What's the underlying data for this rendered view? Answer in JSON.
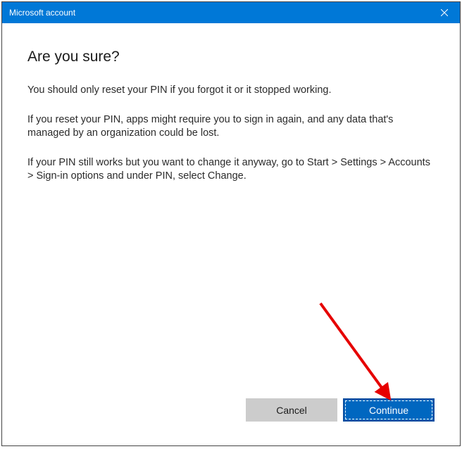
{
  "titlebar": {
    "title": "Microsoft account"
  },
  "dialog": {
    "heading": "Are you sure?",
    "p1": "You should only reset your PIN if you forgot it or it stopped working.",
    "p2": "If you reset your PIN, apps might require you to sign in again, and any data that's managed by an organization could be lost.",
    "p3": "If your PIN still works but you want to change it anyway, go to Start > Settings > Accounts > Sign-in options and under PIN, select Change."
  },
  "buttons": {
    "cancel": "Cancel",
    "continue": "Continue"
  }
}
